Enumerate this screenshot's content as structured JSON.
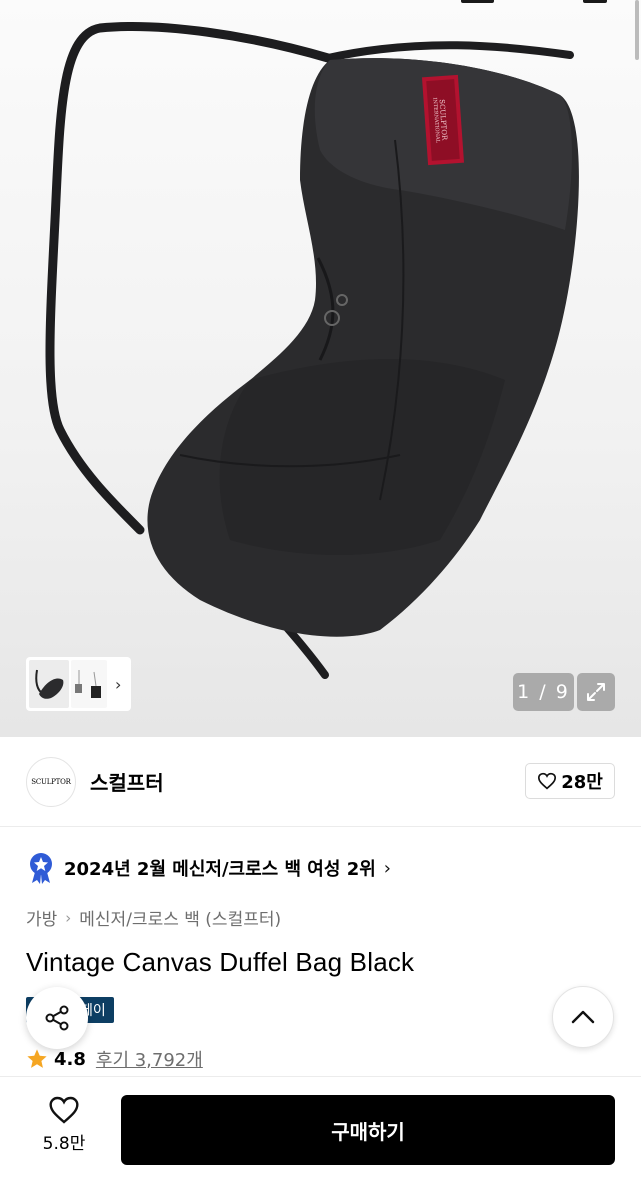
{
  "gallery": {
    "counter": "1 / 9",
    "brand_label_line1": "SCULPTOR",
    "brand_label_line2": "INTERNATIONAL"
  },
  "brand": {
    "logo_text": "SCULPTOR",
    "name": "스컬프터",
    "follow_count": "28만"
  },
  "ranking": {
    "text": "2024년 2월 메신저/크로스 백 여성 2위"
  },
  "breadcrumb": {
    "items": [
      "가방",
      "메신저/크로스 백 (스컬프터)"
    ]
  },
  "product": {
    "title": "Vintage Canvas Duffel Bag Black",
    "badge_text": "페이",
    "rating": "4.8",
    "review_label": "후기 3,792개"
  },
  "bottom": {
    "like_count": "5.8만",
    "buy_label": "구매하기"
  },
  "colors": {
    "badge_bg": "#0d3e63",
    "star": "#f5a623",
    "medal": "#2f5bd6",
    "buy_bg": "#000000"
  }
}
